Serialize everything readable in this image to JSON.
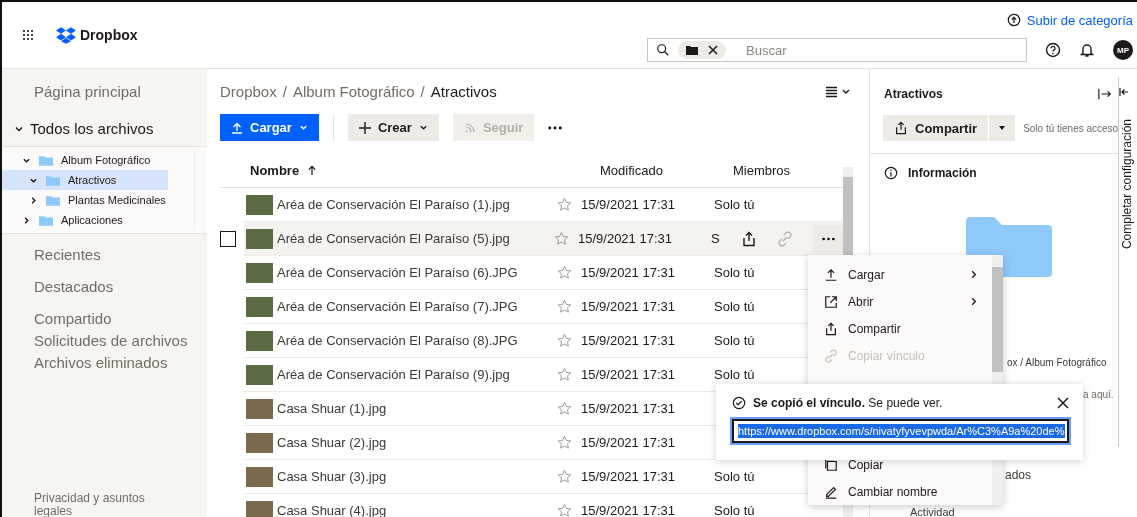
{
  "header": {
    "brand": "Dropbox",
    "upgrade_link": "Subir de categoría",
    "search": {
      "placeholder": "Buscar"
    },
    "avatar": "MP"
  },
  "sidebar": {
    "home": "Página principal",
    "all_files": {
      "label": "Todos los archivos",
      "expanded": true
    },
    "tree": [
      {
        "label": "Album Fotográfico",
        "expanded": true,
        "selected": false,
        "children": [
          {
            "label": "Atractivos",
            "expanded": true,
            "selected": true
          },
          {
            "label": "Plantas Medicinales",
            "expanded": false,
            "selected": false
          }
        ]
      },
      {
        "label": "Aplicaciones",
        "expanded": false,
        "selected": false
      }
    ],
    "nav": [
      "Recientes",
      "Destacados"
    ],
    "nav2": [
      "Compartido",
      "Solicitudes de archivos",
      "Archivos eliminados"
    ],
    "footer": "Privacidad y asuntos legales"
  },
  "main": {
    "breadcrumb": [
      "Dropbox",
      "Album Fotográfico",
      "Atractivos"
    ],
    "breadcrumb_separator": "/",
    "toolbar": {
      "upload": "Cargar",
      "create": "Crear",
      "follow": {
        "label": "Seguir",
        "disabled": true
      }
    },
    "columns": [
      "Nombre",
      "Modificado",
      "Miembros"
    ],
    "rows": [
      {
        "name": "Aréa de Conservación El Paraíso (1).jpg",
        "modified": "15/9/2021 17:31",
        "members": "Solo tú",
        "hovered": false
      },
      {
        "name": "Aréa de Conservación El Paraíso (5).jpg",
        "modified": "15/9/2021 17:31",
        "members": "S",
        "hovered": true
      },
      {
        "name": "Aréa de Conservación El Paraíso (6).JPG",
        "modified": "15/9/2021 17:31",
        "members": "Solo tú",
        "hovered": false
      },
      {
        "name": "Aréa de Conservación El Paraíso (7).JPG",
        "modified": "15/9/2021 17:31",
        "members": "Solo tú",
        "hovered": false
      },
      {
        "name": "Aréa de Conservación El Paraíso (8).JPG",
        "modified": "15/9/2021 17:31",
        "members": "Solo tú",
        "hovered": false
      },
      {
        "name": "Aréa de Conservación El Paraíso (9).jpg",
        "modified": "15/9/2021 17:31",
        "members": "Solo tú",
        "hovered": false
      },
      {
        "name": "Casa Shuar (1).jpg",
        "modified": "15/9/2021 17:31",
        "hovered": false
      },
      {
        "name": "Casa Shuar (2).jpg",
        "modified": "15/9/2021 17:31",
        "hovered": false
      },
      {
        "name": "Casa Shuar (3).jpg",
        "modified": "15/9/2021 17:31",
        "members": "Solo tú",
        "hovered": false
      },
      {
        "name": "Casa Shuar (4).jpg",
        "modified": "15/9/2021 17:31",
        "members": "Solo tú",
        "hovered": false
      }
    ]
  },
  "context_menu": {
    "items_top": [
      {
        "label": "Cargar",
        "kind": "upload",
        "submenu": true,
        "disabled": false
      },
      {
        "label": "Abrir",
        "kind": "open",
        "submenu": true,
        "disabled": false
      },
      {
        "label": "Compartir",
        "kind": "share",
        "submenu": false,
        "disabled": false
      },
      {
        "label": "Copiar vínculo",
        "kind": "link",
        "submenu": false,
        "disabled": true
      }
    ],
    "items_bottom": [
      {
        "label": "Copiar",
        "kind": "copy",
        "disabled": false
      },
      {
        "label": "Cambiar nombre",
        "kind": "rename",
        "disabled": false
      }
    ]
  },
  "toast": {
    "message": "**Se copió el vínculo.** Se puede ver.",
    "url": "https://www.dropbox.com/s/nivatyfyvevpwda/Ar%C3%A9a%20de%"
  },
  "details": {
    "title": "Atractivos",
    "share": "Compartir",
    "access": "Solo tú tienes acceso",
    "info": "Información",
    "path_fragment": "ox / Album Fotográfico",
    "note_fragment": "a aquí.",
    "section_fragment": "ados",
    "activity": "Actividad"
  },
  "setup_tab": "Completar configuración"
}
